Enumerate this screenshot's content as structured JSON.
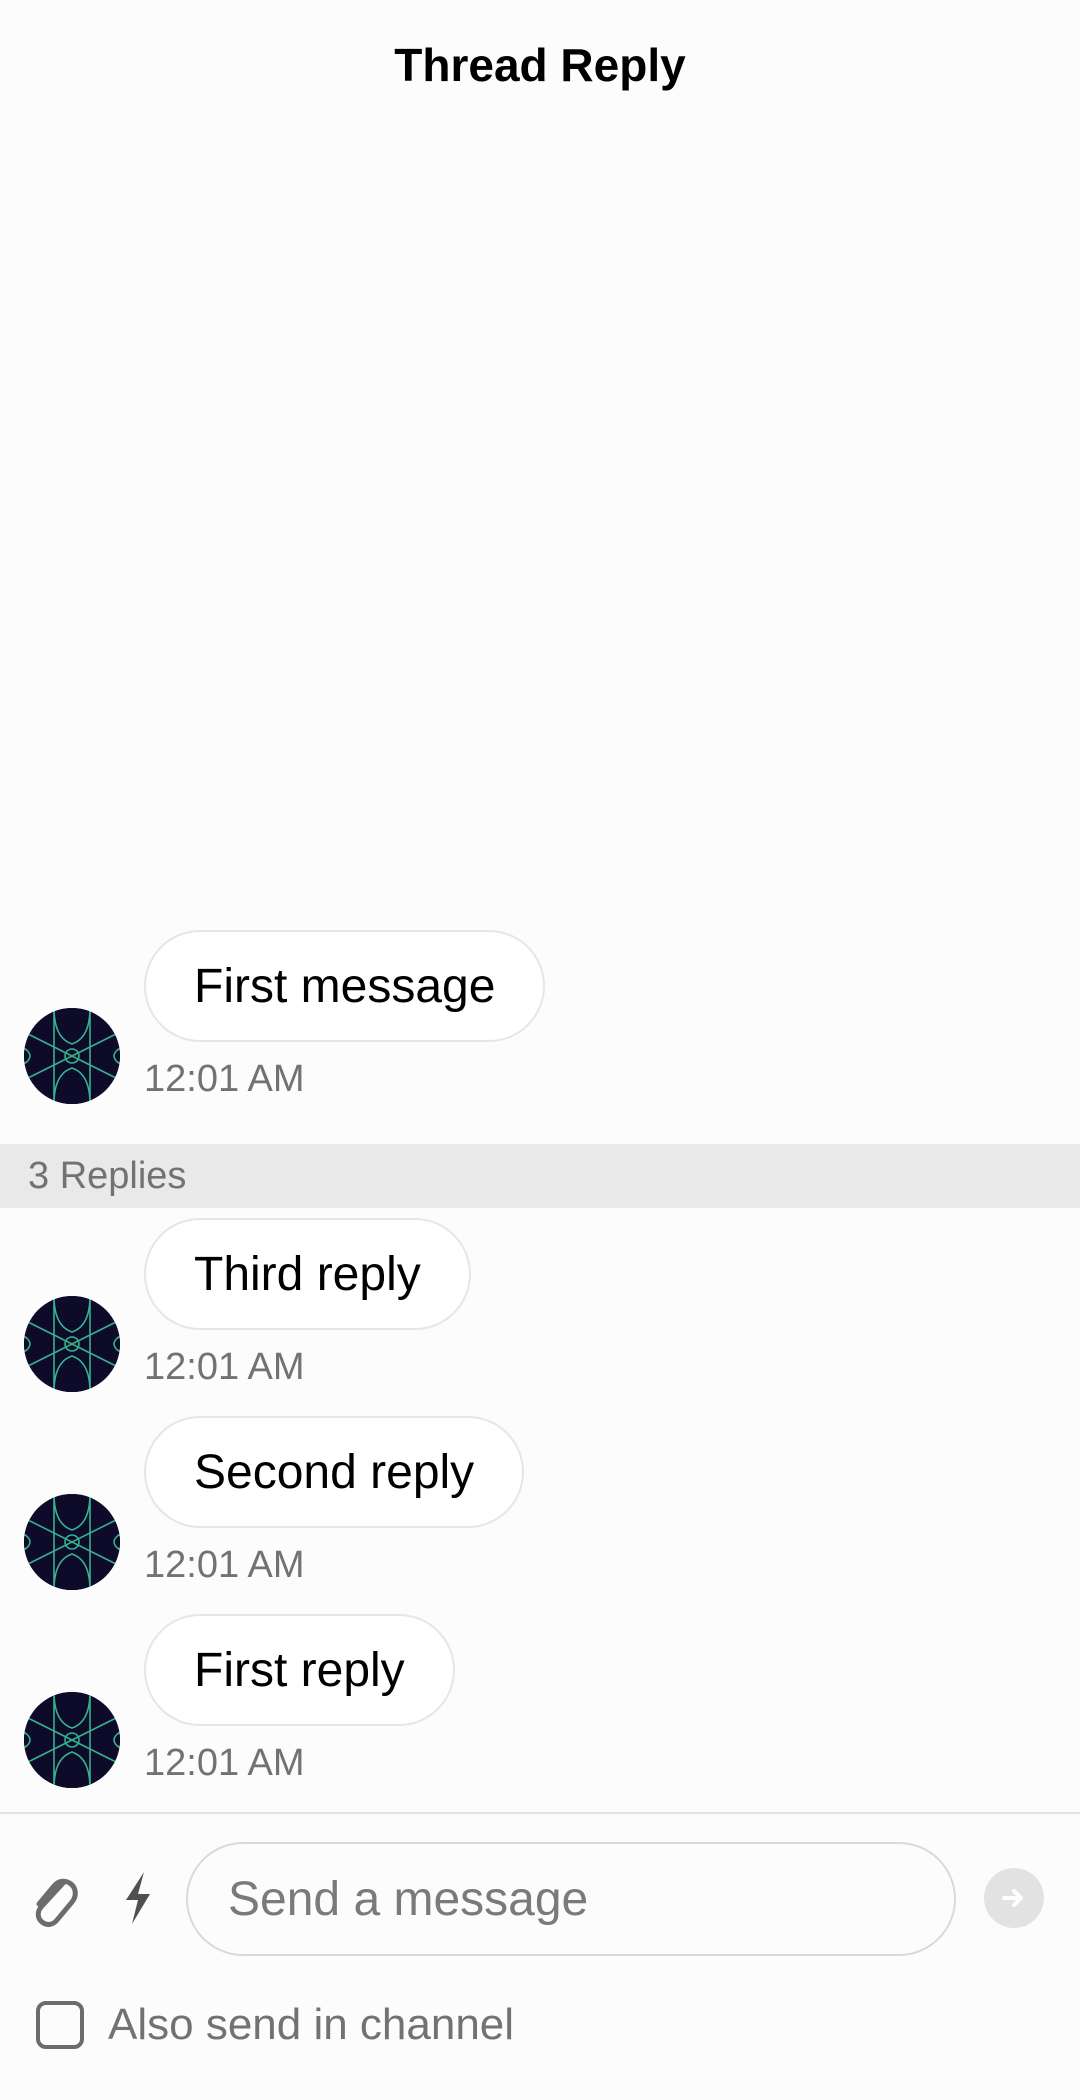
{
  "header": {
    "title": "Thread Reply"
  },
  "parent_message": {
    "text": "First message",
    "time": "12:01 AM",
    "avatar": "user-avatar"
  },
  "replies_count_label": "3 Replies",
  "replies": [
    {
      "text": "Third reply",
      "time": "12:01 AM",
      "avatar": "user-avatar"
    },
    {
      "text": "Second reply",
      "time": "12:01 AM",
      "avatar": "user-avatar"
    },
    {
      "text": "First reply",
      "time": "12:01 AM",
      "avatar": "user-avatar"
    }
  ],
  "composer": {
    "placeholder": "Send a message",
    "value": "",
    "attach_icon": "paperclip-icon",
    "commands_icon": "lightning-icon",
    "send_icon": "arrow-right-icon"
  },
  "also_send": {
    "label": "Also send in channel",
    "checked": false
  },
  "colors": {
    "avatar_bg": "#0d0a2a",
    "avatar_pattern": "#3ed0a0"
  }
}
